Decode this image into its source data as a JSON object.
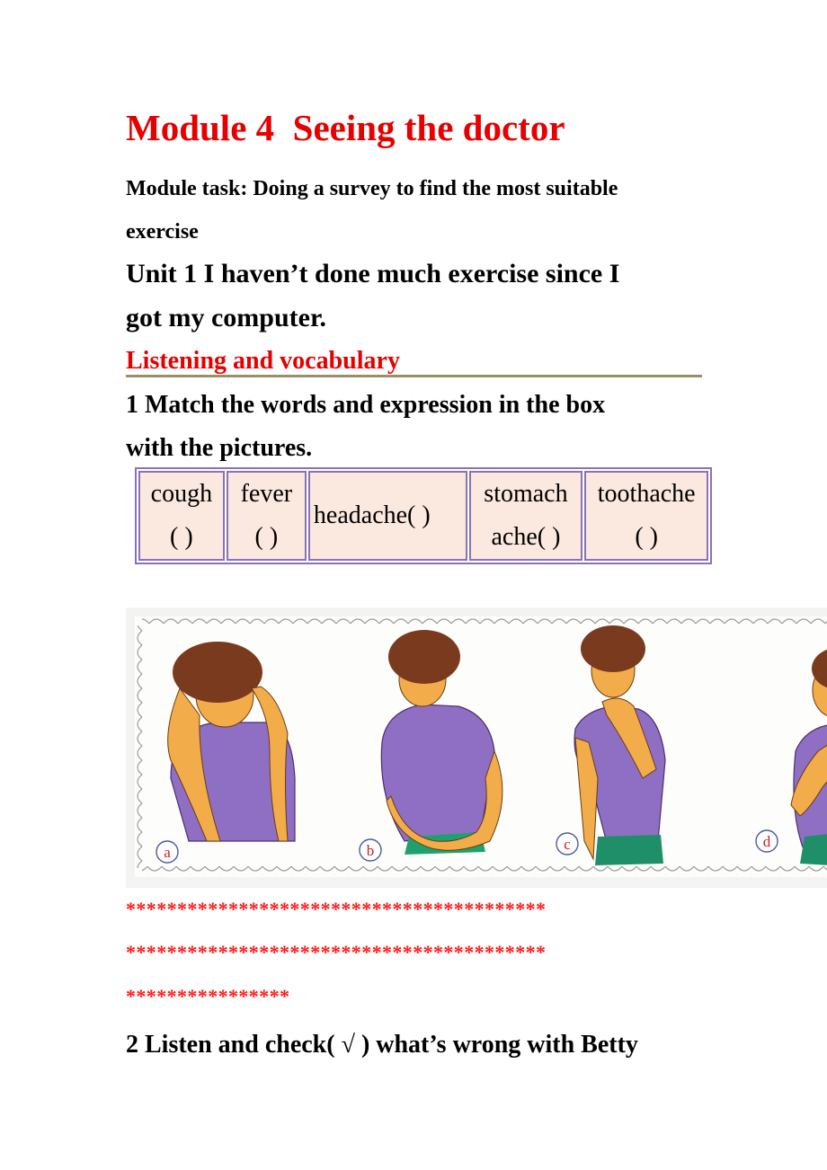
{
  "module_title": "Module 4  Seeing the doctor",
  "module_task": {
    "line1": "Module task: Doing a survey to find the most suitable",
    "line2": "exercise"
  },
  "unit_title": {
    "line1": "Unit 1 I haven’t done much exercise since I",
    "line2": "got my computer."
  },
  "section_heading": "Listening and vocabulary",
  "question1": {
    "line1": "1 Match the words and expression in the box",
    "line2": "with the pictures."
  },
  "word_box": [
    {
      "word": "cough",
      "blank": "(   )"
    },
    {
      "word": "fever",
      "blank": "(   )"
    },
    {
      "word": "headache(     )"
    },
    {
      "word": "stomach",
      "blank": "ache(    )"
    },
    {
      "word": "toothache",
      "blank": "(   )"
    }
  ],
  "illustration": {
    "labels": [
      "a",
      "b",
      "c",
      "d"
    ],
    "colors": {
      "shirt": "#8f6fc4",
      "skin": "#f2ad4a",
      "hair": "#7a3a1e",
      "shorts": "#1f8f6a"
    }
  },
  "separator_lines": [
    "*****************************************",
    "*****************************************",
    "****************"
  ],
  "question2": "2 Listen and check( √ ) what’s wrong with Betty",
  "colors": {
    "accent_red": "#e60000",
    "table_border": "#8a72b6",
    "table_fill": "#fbe8df",
    "rule": "#9a9068"
  }
}
